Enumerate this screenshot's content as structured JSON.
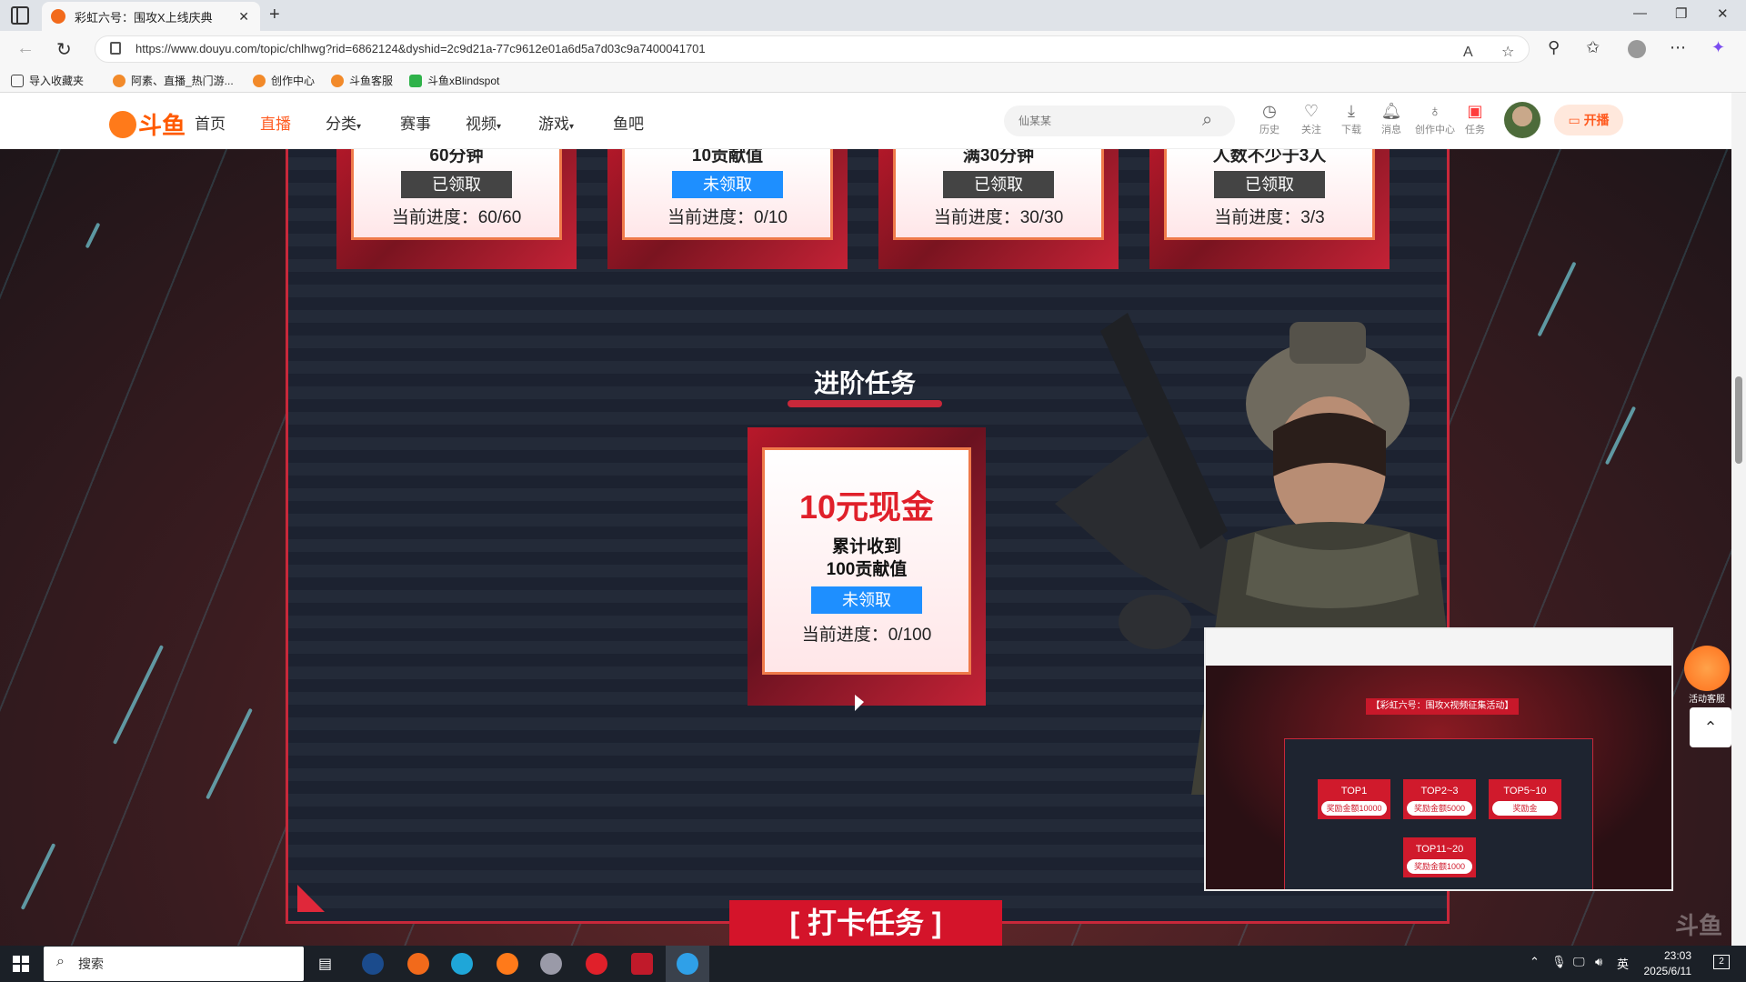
{
  "browser": {
    "tab_title": "彩虹六号：围攻X上线庆典",
    "url": "https://www.douyu.com/topic/chlhwg?rid=6862124&dyshid=2c9d21a-77c9612e01a6d5a7d03c9a7400041701",
    "bookmarks": [
      "导入收藏夹",
      "阿素、直播_热门游...",
      "创作中心",
      "斗鱼客服",
      "斗鱼xBlindspot"
    ]
  },
  "site_header": {
    "logo_text": "斗鱼",
    "nav": [
      "首页",
      "直播",
      "分类",
      "赛事",
      "视频",
      "游戏",
      "鱼吧"
    ],
    "active_nav": "直播",
    "search_placeholder": "仙某某",
    "icons": [
      {
        "label": "历史",
        "icon": "history-icon"
      },
      {
        "label": "关注",
        "icon": "heart-icon"
      },
      {
        "label": "下载",
        "icon": "download-icon"
      },
      {
        "label": "消息",
        "icon": "bell-icon"
      },
      {
        "label": "创作中心",
        "icon": "bulb-icon"
      },
      {
        "label": "任务",
        "icon": "gift-icon"
      }
    ],
    "live_button": "开播"
  },
  "daily_tasks": [
    {
      "title": "60分钟",
      "button": "已领取",
      "status": "done",
      "progress": "当前进度：60/60"
    },
    {
      "title": "10贡献值",
      "button": "未领取",
      "status": "todo",
      "progress": "当前进度：0/10"
    },
    {
      "title": "满30分钟",
      "button": "已领取",
      "status": "done",
      "progress": "当前进度：30/30"
    },
    {
      "title": "人数不少于3人",
      "button": "已领取",
      "status": "done",
      "progress": "当前进度：3/3"
    }
  ],
  "advanced": {
    "section_title": "进阶任务",
    "reward": "10元现金",
    "desc_line1": "累计收到",
    "desc_line2": "100贡献值",
    "button": "未领取",
    "progress": "当前进度：0/100"
  },
  "checkin_banner": "[ 打卡任务 ]",
  "mini_player": {
    "title": "【彩虹六号：围攻X视频征集活动】",
    "cards": [
      {
        "rank": "TOP1",
        "reward": "奖励金额10000"
      },
      {
        "rank": "TOP2~3",
        "reward": "奖励金额5000"
      },
      {
        "rank": "TOP5~10",
        "reward": "奖励金"
      },
      {
        "rank": "TOP11~20",
        "reward": "奖励金额1000"
      }
    ]
  },
  "service_label": "活动客服",
  "watermark": "斗鱼",
  "taskbar": {
    "search_placeholder": "搜索",
    "ime": "英",
    "time": "23:03",
    "date": "2025/6/11",
    "notifications": "2"
  },
  "colors": {
    "accent": "#ff5d23",
    "task_red": "#c8283a",
    "claimed_button": "#444444",
    "claim_button": "#1e8fff"
  }
}
